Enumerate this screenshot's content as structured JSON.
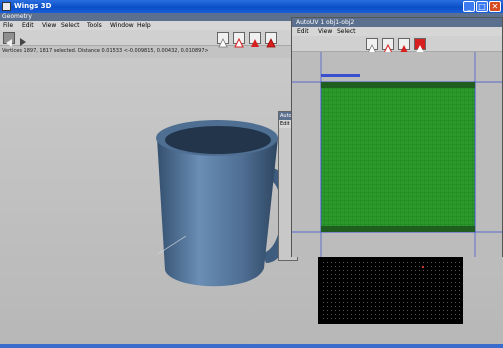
{
  "app": {
    "title": "Wings 3D"
  },
  "window_controls": {
    "minimize": "_",
    "maximize": "□",
    "close": "✕"
  },
  "geometry": {
    "title": "Geometry",
    "menu": [
      "File",
      "Edit",
      "View",
      "Select",
      "Tools",
      "Window",
      "Help"
    ],
    "status": "Vertices 1897, 1817 selected. Distance 0.01533  <-0.009815, 0.00432, 0.010897>"
  },
  "autouv_stub": {
    "title": "Auto",
    "menu": "Edit"
  },
  "uv_window": {
    "title": "AutoUV 1 obj1-obj2",
    "menu": [
      "Edit",
      "View",
      "Select"
    ]
  },
  "colors": {
    "mug": "#5b7fa6",
    "uv_fill": "#2e9e2e",
    "uv_border": "#3a4fd0",
    "mode_red": "#d81f1f"
  },
  "icons": [
    "wings-logo-icon",
    "back-arrow-icon",
    "forward-arrow-icon",
    "vertex-mode-icon",
    "edge-mode-icon",
    "face-mode-icon",
    "body-mode-icon"
  ]
}
